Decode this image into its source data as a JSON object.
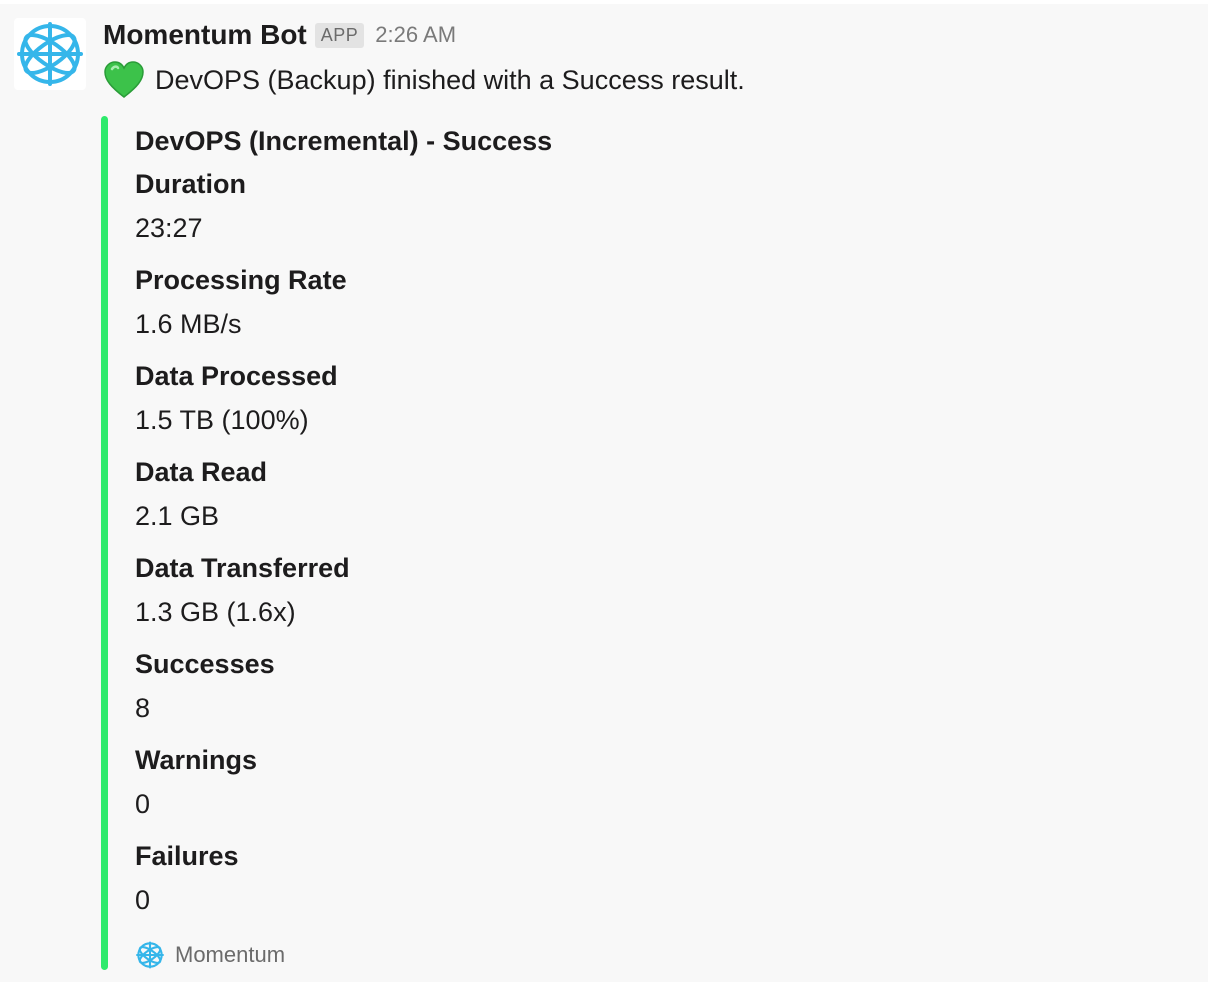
{
  "message": {
    "bot_name": "Momentum Bot",
    "badge": "APP",
    "timestamp": "2:26 AM",
    "icon": "green-heart-icon",
    "text": "DevOPS (Backup)  finished with a Success result."
  },
  "attachment": {
    "accent_color": "#2eea6c",
    "title": "DevOPS (Incremental) - Success",
    "fields": [
      {
        "title": "Duration",
        "value": "23:27"
      },
      {
        "title": "Processing Rate",
        "value": "1.6 MB/s"
      },
      {
        "title": "Data Processed",
        "value": "1.5 TB (100%)"
      },
      {
        "title": "Data Read",
        "value": "2.1 GB"
      },
      {
        "title": "Data Transferred",
        "value": "1.3 GB (1.6x)"
      },
      {
        "title": "Successes",
        "value": "8"
      },
      {
        "title": "Warnings",
        "value": "0"
      },
      {
        "title": "Failures",
        "value": "0"
      }
    ],
    "footer": {
      "icon": "momentum-logo-icon",
      "text": "Momentum"
    }
  },
  "colors": {
    "logo": "#35b6ea",
    "heart": "#3cc24a"
  }
}
